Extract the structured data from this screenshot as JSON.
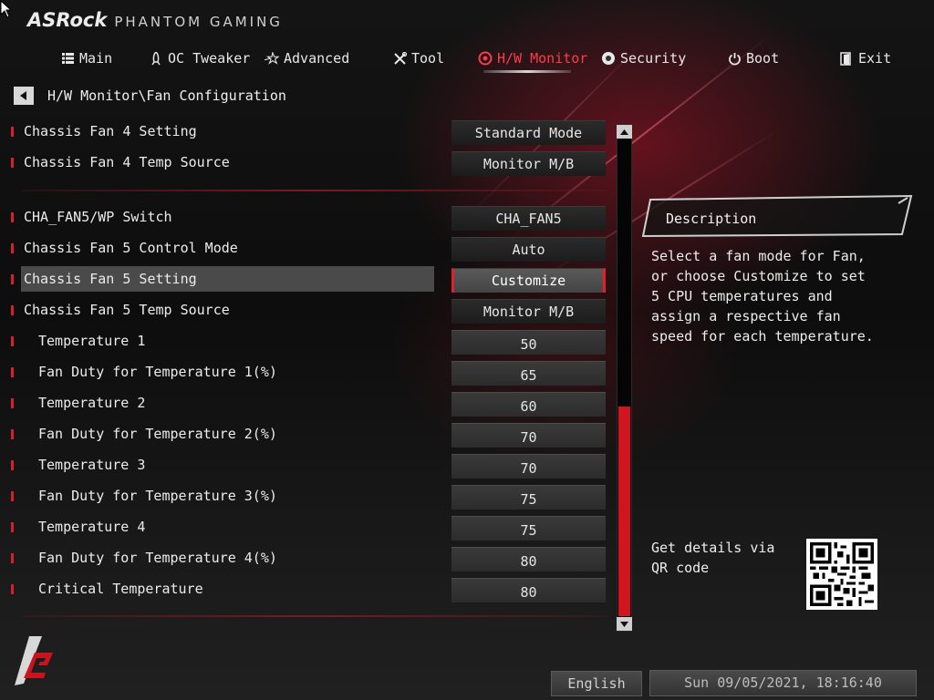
{
  "header": {
    "brand": "ASRock",
    "subtitle": "PHANTOM GAMING"
  },
  "nav": {
    "items": [
      {
        "label": "Main",
        "icon": "list-icon"
      },
      {
        "label": "OC Tweaker",
        "icon": "rocket-icon"
      },
      {
        "label": "Advanced",
        "icon": "star-icon"
      },
      {
        "label": "Tool",
        "icon": "tools-icon"
      },
      {
        "label": "H/W Monitor",
        "icon": "monitor-gauge-icon",
        "active": true
      },
      {
        "label": "Security",
        "icon": "shield-icon"
      },
      {
        "label": "Boot",
        "icon": "power-icon"
      },
      {
        "label": "Exit",
        "icon": "exit-door-icon"
      }
    ]
  },
  "breadcrumb": {
    "path": "H/W Monitor\\Fan Configuration"
  },
  "settings": {
    "group_a": [
      {
        "label": "Chassis Fan 4 Setting",
        "value": "Standard Mode"
      },
      {
        "label": "Chassis Fan 4 Temp Source",
        "value": "Monitor M/B"
      }
    ],
    "group_b": [
      {
        "label": "CHA_FAN5/WP Switch",
        "value": "CHA_FAN5"
      },
      {
        "label": "Chassis Fan 5 Control Mode",
        "value": "Auto"
      },
      {
        "label": "Chassis Fan 5 Setting",
        "value": "Customize",
        "selected": true
      },
      {
        "label": "Chassis Fan 5 Temp Source",
        "value": "Monitor M/B"
      }
    ],
    "points": [
      {
        "label": "Temperature 1",
        "value": "50"
      },
      {
        "label": "Fan Duty for Temperature 1(%)",
        "value": "65"
      },
      {
        "label": "Temperature 2",
        "value": "60"
      },
      {
        "label": "Fan Duty for Temperature 2(%)",
        "value": "70"
      },
      {
        "label": "Temperature 3",
        "value": "70"
      },
      {
        "label": "Fan Duty for Temperature 3(%)",
        "value": "75"
      },
      {
        "label": "Temperature 4",
        "value": "75"
      },
      {
        "label": "Fan Duty for Temperature 4(%)",
        "value": "80"
      },
      {
        "label": "Critical Temperature",
        "value": "80"
      }
    ]
  },
  "description": {
    "title": "Description",
    "text": "Select a fan mode for Fan, or choose Customize to set 5 CPU temperatures and assign a respective fan speed for each temperature."
  },
  "qr": {
    "text": "Get details via QR code"
  },
  "footer": {
    "language": "English",
    "datetime": "Sun 09/05/2021, 18:16:40"
  },
  "colors": {
    "accent": "#d81f2c",
    "active_tab": "#ff3b4a",
    "text": "#e4e4e4"
  }
}
